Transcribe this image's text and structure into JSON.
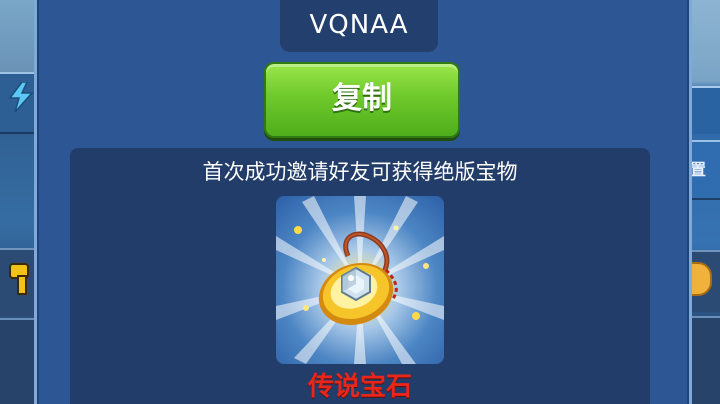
{
  "invite": {
    "code": "VQNAA",
    "copy_label": "复制",
    "reward_title": "首次成功邀请好友可获得绝版宝物",
    "reward_item_name": "传说宝石",
    "reward_item_icon": "legendary-gem-icon"
  },
  "background": {
    "right_partial_text": "置"
  },
  "colors": {
    "panel": "#2c5694",
    "copy_button": "#6fc92b",
    "item_name": "#e8261c"
  }
}
